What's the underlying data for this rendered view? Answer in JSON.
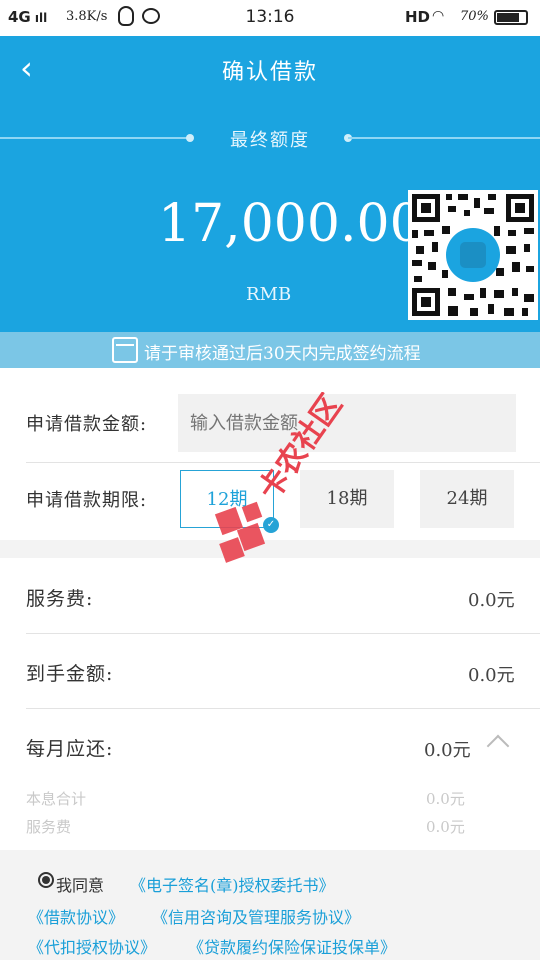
{
  "status_bar": {
    "network": "4G",
    "speed": "3.8K/s",
    "time": "13:16",
    "hd": "HD",
    "battery": "70%"
  },
  "header": {
    "title": "确认借款",
    "subtitle": "最终额度",
    "amount": "17,000.00",
    "currency": "RMB"
  },
  "notice": {
    "text": "请于审核通过后30天内完成签约流程"
  },
  "form": {
    "amount_label": "申请借款金额:",
    "amount_placeholder": "输入借款金额",
    "term_label": "申请借款期限:",
    "terms": [
      "12期",
      "18期",
      "24期"
    ],
    "selected_term": "12期"
  },
  "fees": {
    "service_label": "服务费:",
    "service_value": "0.0元",
    "received_label": "到手金额:",
    "received_value": "0.0元",
    "monthly_label": "每月应还:",
    "monthly_value": "0.0元",
    "principal_interest_label": "本息合计",
    "principal_interest_value": "0.0元",
    "service_fee_sub_label": "服务费",
    "service_fee_sub_value": "0.0元"
  },
  "agreements": {
    "agree_text": "我同意",
    "links": [
      "《电子签名(章)授权委托书》",
      "《借款协议》",
      "《信用咨询及管理服务协议》",
      "《代扣授权协议》",
      "《贷款履约保险保证投保单》"
    ]
  },
  "watermark": {
    "text": "卡农社区"
  },
  "colors": {
    "header_blue": "#1ba4e0",
    "notice_blue": "#7bc6e6",
    "link_blue": "#1a9fd8",
    "watermark_red": "#e8434f"
  }
}
